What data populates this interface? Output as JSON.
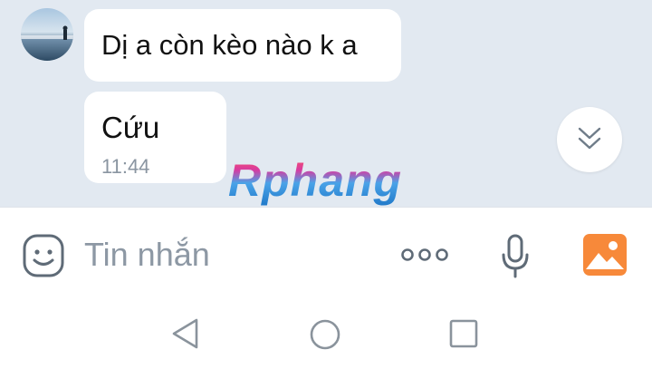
{
  "conversation": {
    "messages": [
      {
        "text": "Dị a còn kèo nào k a"
      },
      {
        "text": "Cứu",
        "time": "11:44"
      }
    ]
  },
  "watermark": {
    "text": "Rphang"
  },
  "composer": {
    "placeholder": "Tin nhắn",
    "icons": {
      "emoji": "smiley-sticker-icon",
      "more": "more-dots-icon",
      "mic": "microphone-icon",
      "image": "image-gallery-icon"
    }
  },
  "scroll_button": {
    "icon": "double-chevron-down-icon"
  },
  "system_nav": {
    "icons": [
      "back-triangle-icon",
      "home-circle-icon",
      "recents-square-icon"
    ]
  },
  "colors": {
    "chat_background": "#e2e9f1",
    "bubble": "#ffffff",
    "placeholder": "#8d98a4",
    "image_icon": "#f7893a",
    "timestamp": "#8a95a1"
  }
}
